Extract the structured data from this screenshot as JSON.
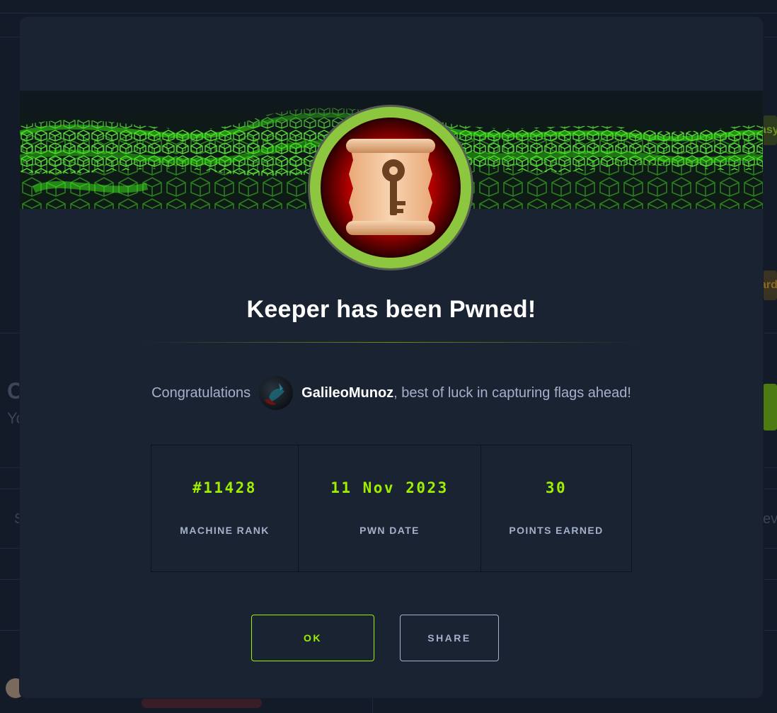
{
  "modal": {
    "title": "Keeper has been Pwned!",
    "congrats": {
      "prefix": "Congratulations",
      "username": "GalileoMunoz",
      "suffix": ", best of luck in capturing flags ahead!"
    },
    "stats": [
      {
        "value": "#11428",
        "label": "MACHINE RANK"
      },
      {
        "value": "11 Nov 2023",
        "label": "PWN DATE"
      },
      {
        "value": "30",
        "label": "POINTS EARNED"
      }
    ],
    "buttons": {
      "ok": "OK",
      "share": "SHARE"
    }
  },
  "background": {
    "left_heading_fragment": "C",
    "left_sub_fragment": "Yo",
    "left_row_fragment": "S",
    "right_badge_easy": "asy",
    "right_badge_hard": "ard",
    "right_row_fragment": "ev"
  },
  "colors": {
    "accent": "#9fef00",
    "modal_bg": "#1a2332",
    "text_muted": "#a4b1cd",
    "badge_ring": "#8dc63f",
    "badge_center": "#b00000"
  },
  "icons": {
    "badge": "scroll-key-icon"
  }
}
